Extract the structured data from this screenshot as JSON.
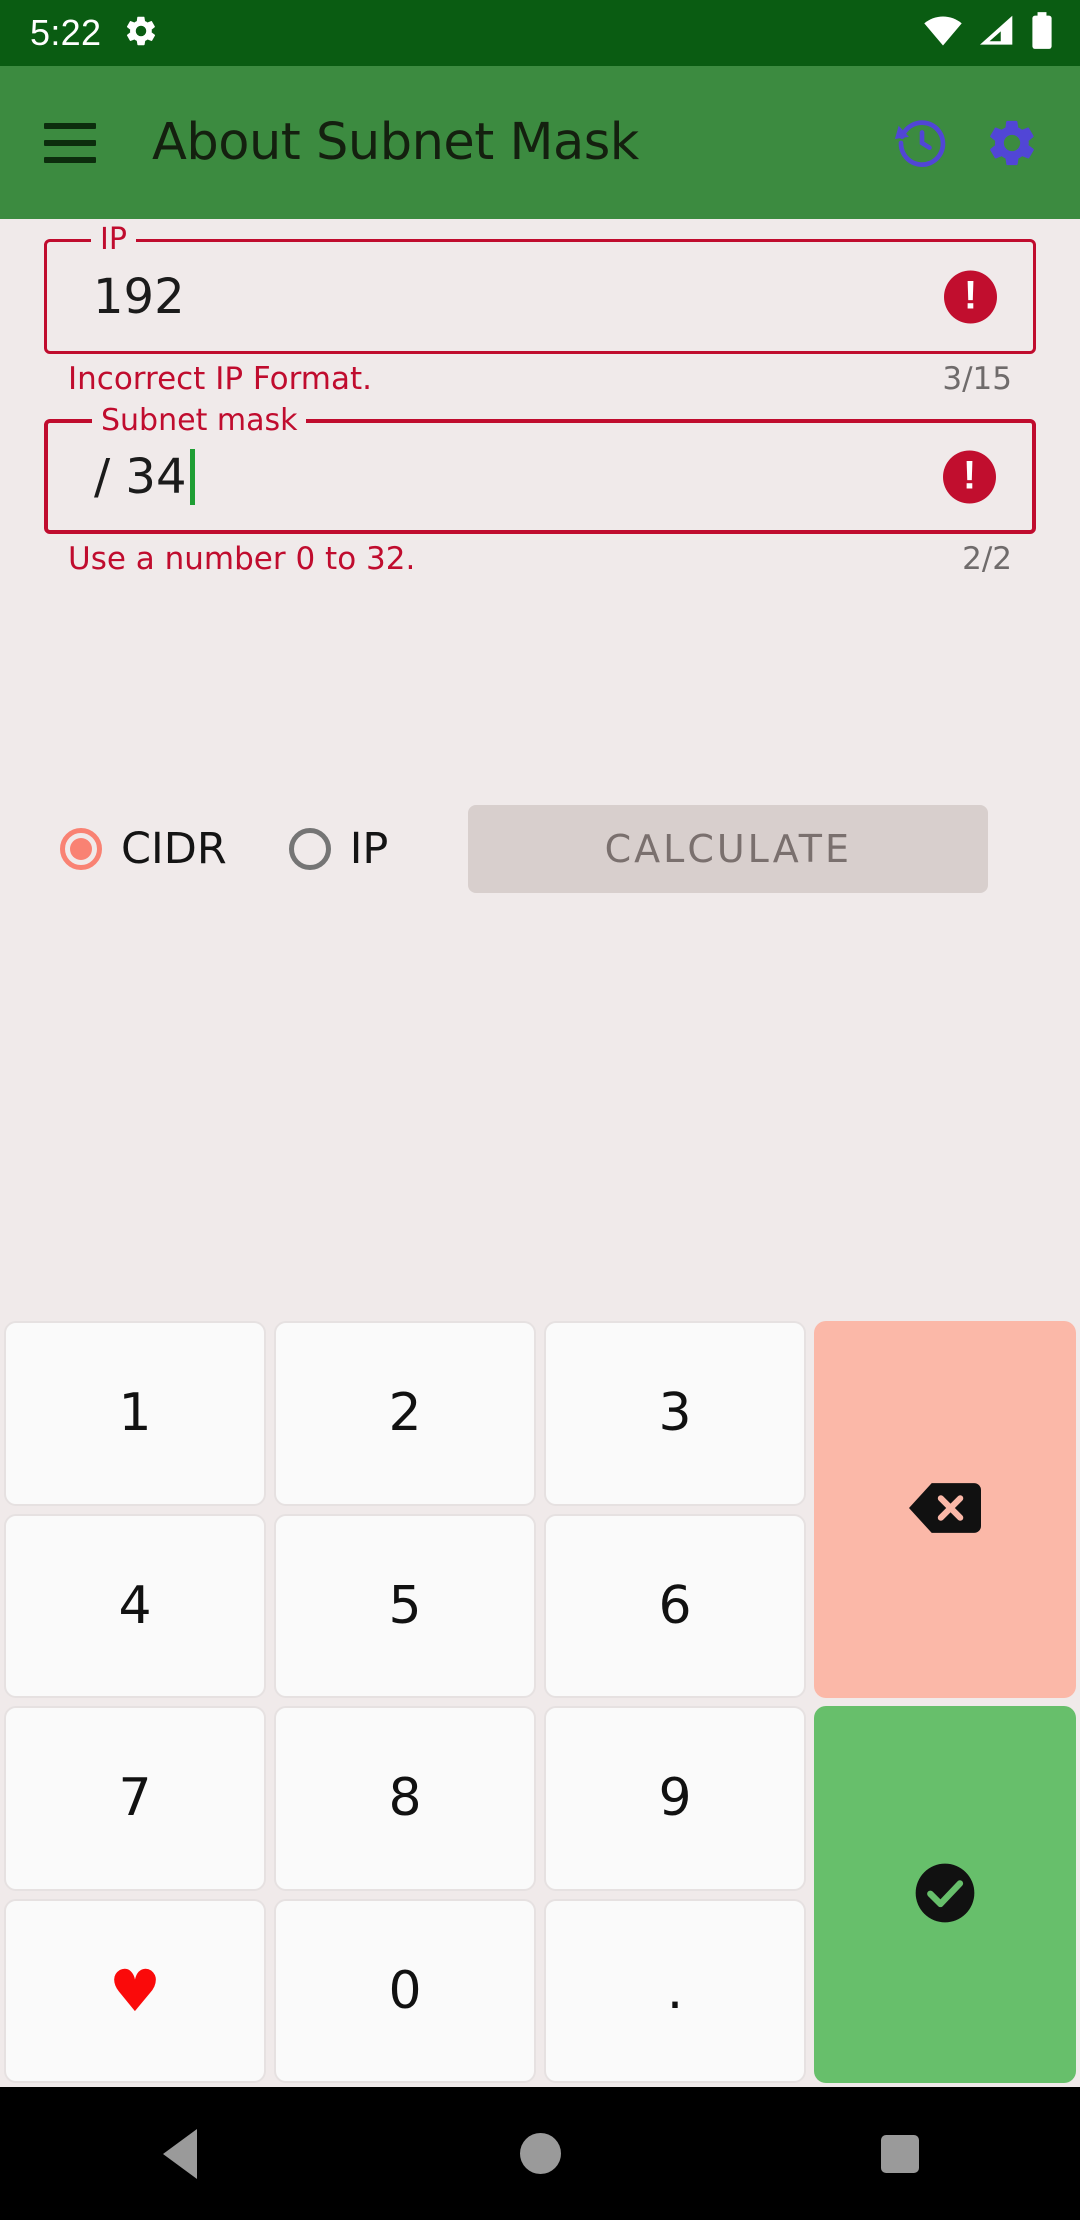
{
  "status_bar": {
    "time": "5:22",
    "left_icons": [
      "gear-icon"
    ],
    "right_icons": [
      "wifi-icon",
      "cell-signal-icon",
      "battery-icon"
    ],
    "background_color": "#0a5c12"
  },
  "app_bar": {
    "menu_icon": "hamburger-menu-icon",
    "title": "About Subnet Mask",
    "actions": [
      {
        "name": "history-icon",
        "color": "#5146d6"
      },
      {
        "name": "settings-gear-icon",
        "color": "#5146d6"
      }
    ],
    "background_color": "#3c8b40"
  },
  "form": {
    "ip_field": {
      "label": "IP",
      "value": "192",
      "helper_text": "Incorrect IP Format.",
      "counter": "3/15",
      "state": "error",
      "error_icon": "error-exclamation-icon"
    },
    "mask_field": {
      "label": "Subnet mask",
      "value": "/ 34",
      "helper_text": "Use a number 0 to 32.",
      "counter": "2/2",
      "state": "error",
      "focused": true,
      "error_icon": "error-exclamation-icon"
    },
    "error_color": "#c00c2e",
    "counter_color": "#6f6b6b"
  },
  "options": {
    "radios": [
      {
        "label": "CIDR",
        "selected": true
      },
      {
        "label": "IP",
        "selected": false
      }
    ],
    "selected_color": "#f98273",
    "calculate_button": {
      "label": "CALCULATE",
      "enabled": false,
      "background_color": "#d8cfcd",
      "text_color": "#7a706e"
    }
  },
  "keypad": {
    "keys": [
      {
        "label": "1",
        "name": "key-1",
        "type": "num"
      },
      {
        "label": "2",
        "name": "key-2",
        "type": "num"
      },
      {
        "label": "3",
        "name": "key-3",
        "type": "num"
      },
      {
        "label": "4",
        "name": "key-4",
        "type": "num"
      },
      {
        "label": "5",
        "name": "key-5",
        "type": "num"
      },
      {
        "label": "6",
        "name": "key-6",
        "type": "num"
      },
      {
        "label": "7",
        "name": "key-7",
        "type": "num"
      },
      {
        "label": "8",
        "name": "key-8",
        "type": "num"
      },
      {
        "label": "9",
        "name": "key-9",
        "type": "num"
      },
      {
        "label": "♥",
        "name": "key-favorite",
        "type": "heart"
      },
      {
        "label": "0",
        "name": "key-0",
        "type": "num"
      },
      {
        "label": ".",
        "name": "key-dot",
        "type": "dot"
      }
    ],
    "backspace": {
      "icon": "backspace-icon",
      "background_color": "#fbb8a8"
    },
    "enter": {
      "icon": "check-confirm-icon",
      "background_color": "#67bf6b"
    }
  },
  "nav_bar": {
    "back": "back-triangle-icon",
    "home": "home-circle-icon",
    "recents": "recents-square-icon"
  }
}
